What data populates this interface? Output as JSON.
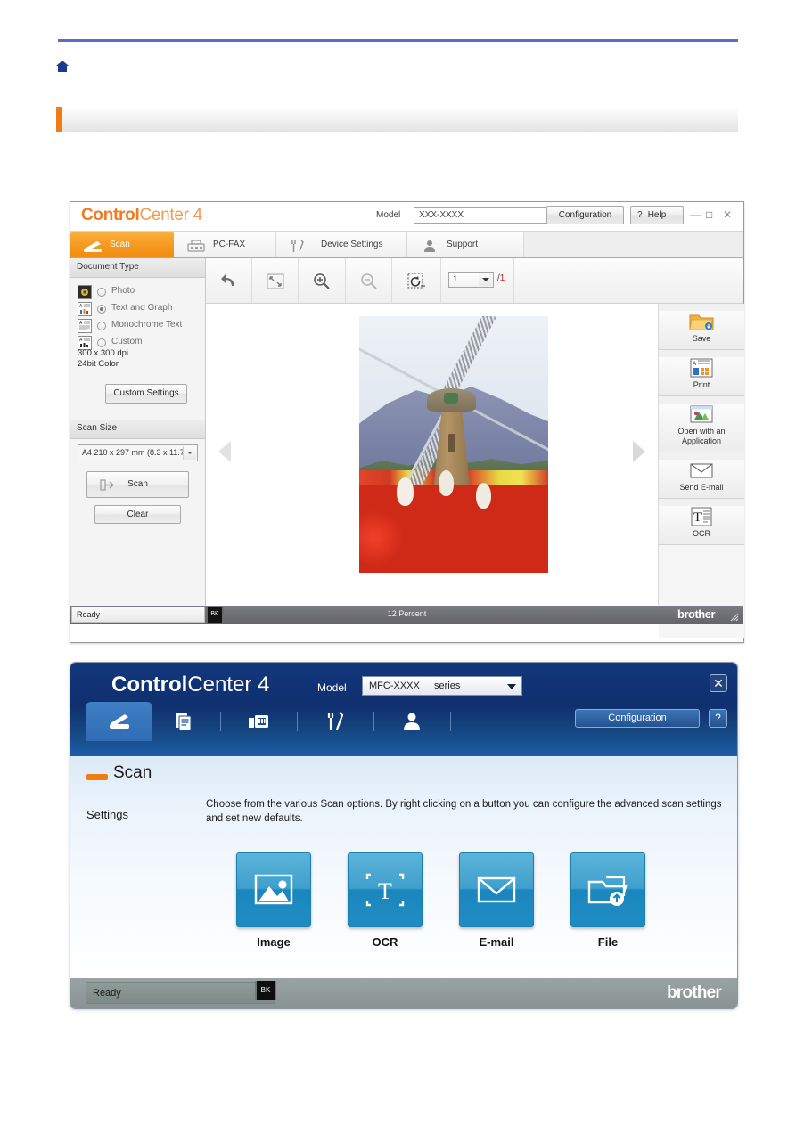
{
  "page": {
    "breadcrumb_home_icon": "home-icon",
    "section_title": ""
  },
  "advanced_window": {
    "brand_bold": "Control",
    "brand_light": "Center 4",
    "model_label": "Model",
    "model_value": "XXX-XXXX",
    "configuration_label": "Configuration",
    "help_label": "Help",
    "help_mark": "?",
    "window_controls": {
      "minimize": "—",
      "maximize": "□",
      "close": "✕"
    },
    "tabs": [
      {
        "label": "Scan",
        "icon": "scanner-icon",
        "active": true
      },
      {
        "label": "PC-FAX",
        "icon": "fax-icon",
        "active": false
      },
      {
        "label": "Device Settings",
        "icon": "tools-icon",
        "active": false
      },
      {
        "label": "Support",
        "icon": "person-icon",
        "active": false
      }
    ],
    "document_type": {
      "group_label": "Document Type",
      "options": [
        {
          "label": "Photo",
          "selected": false,
          "icon": "photo-icon"
        },
        {
          "label": "Text and Graph",
          "selected": true,
          "icon": "text-graph-icon"
        },
        {
          "label": "Monochrome Text",
          "selected": false,
          "icon": "mono-text-icon"
        },
        {
          "label": "Custom",
          "selected": false,
          "icon": "custom-icon"
        }
      ],
      "resolution": "300 x 300 dpi",
      "color_depth": "24bit Color",
      "custom_settings_label": "Custom Settings"
    },
    "scan_size": {
      "group_label": "Scan Size",
      "selected": "A4 210 x 297 mm (8.3 x 11.7",
      "scan_label": "Scan",
      "clear_label": "Clear"
    },
    "toolbar": {
      "items": [
        {
          "icon": "undo-icon",
          "name": "undo-button"
        },
        {
          "icon": "fit-to-window-icon",
          "name": "fit-to-window-button"
        },
        {
          "icon": "zoom-in-icon",
          "name": "zoom-in-button"
        },
        {
          "icon": "zoom-out-icon",
          "name": "zoom-out-button"
        },
        {
          "icon": "crop-rotate-icon",
          "name": "crop-rotate-button"
        }
      ],
      "page_current": "1",
      "page_separator": "/",
      "page_total": "1"
    },
    "preview": {
      "nav_prev_icon": "chevron-left-icon",
      "nav_next_icon": "chevron-right-icon",
      "image_caption": "windmill-tulip-photo"
    },
    "actions": [
      {
        "label": "Save",
        "icon": "save-folder-icon"
      },
      {
        "label": "Print",
        "icon": "print-icon"
      },
      {
        "label": "Open with an Application",
        "label_line1": "Open with an",
        "label_line2": "Application",
        "icon": "open-application-icon"
      },
      {
        "label": "Send E-mail",
        "icon": "envelope-icon"
      },
      {
        "label": "OCR",
        "icon": "ocr-icon"
      }
    ],
    "status": {
      "state": "Ready",
      "ink": "BK",
      "zoom_level": "12 Percent",
      "brand": "brother"
    }
  },
  "home_window": {
    "brand_bold": "Control",
    "brand_light": "Center 4",
    "model_label": "Model",
    "model_value": "MFC-XXXX",
    "model_series": "series",
    "close_label": "✕",
    "configuration_label": "Configuration",
    "help_label": "?",
    "tabs": [
      {
        "icon": "scanner-icon",
        "name": "tab-scan",
        "active": true
      },
      {
        "icon": "document-icon",
        "name": "tab-pc-fax",
        "active": false
      },
      {
        "icon": "fax-machine-icon",
        "name": "tab-device-settings",
        "active": false
      },
      {
        "icon": "tools-icon",
        "name": "tab-tools",
        "active": false
      },
      {
        "icon": "person-icon",
        "name": "tab-support",
        "active": false
      }
    ],
    "scan_title": "Scan",
    "settings_label": "Settings",
    "description": "Choose from the various Scan options. By right clicking on a button you can configure the advanced scan settings and set new defaults.",
    "buttons": [
      {
        "label": "Image",
        "icon": "image-icon"
      },
      {
        "label": "OCR",
        "icon": "ocr-text-icon"
      },
      {
        "label": "E-mail",
        "icon": "envelope-icon"
      },
      {
        "label": "File",
        "icon": "file-folder-icon"
      }
    ],
    "status": {
      "state": "Ready",
      "ink": "BK",
      "brand": "brother"
    }
  },
  "colors": {
    "rule_blue": "#5b6cc4",
    "accent_orange": "#f07c14",
    "brand_orange": "#ef7c22",
    "home_blue": "#13387e",
    "tile_blue": "#1b86bd",
    "page_total_red": "#cc2222"
  }
}
